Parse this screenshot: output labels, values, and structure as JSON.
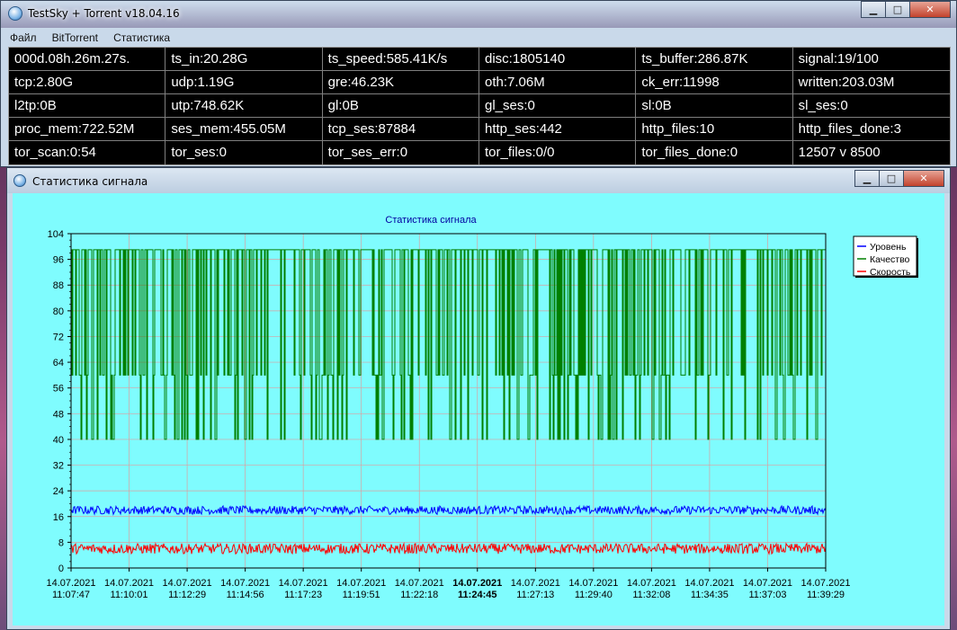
{
  "window": {
    "title": "TestSky + Torrent v18.04.16"
  },
  "menu": [
    "Файл",
    "BitTorrent",
    "Статистика"
  ],
  "stats": [
    [
      "000d.08h.26m.27s.",
      "ts_in:20.28G",
      "ts_speed:585.41K/s",
      "disc:1805140",
      "ts_buffer:286.87K",
      "signal:19/100"
    ],
    [
      "tcp:2.80G",
      "udp:1.19G",
      "gre:46.23K",
      "oth:7.06M",
      "ck_err:11998",
      "written:203.03M"
    ],
    [
      "l2tp:0B",
      "utp:748.62K",
      "gl:0B",
      "gl_ses:0",
      "sl:0B",
      "sl_ses:0"
    ],
    [
      "proc_mem:722.52M",
      "ses_mem:455.05M",
      "tcp_ses:87884",
      "http_ses:442",
      "http_files:10",
      "http_files_done:3"
    ],
    [
      "tor_scan:0:54",
      "tor_ses:0",
      "tor_ses_err:0",
      "tor_files:0/0",
      "tor_files_done:0",
      "12507 v 8500"
    ]
  ],
  "child_window": {
    "title": "Статистика сигнала"
  },
  "colors": {
    "background": "#7ffcfe",
    "level": "#0000ff",
    "quality": "#008000",
    "speed": "#ff0000",
    "grid": "#d9a0a0"
  },
  "chart_data": {
    "type": "line",
    "title": "Статистика сигнала",
    "ylim": [
      0,
      104
    ],
    "yticks": [
      0,
      8,
      16,
      24,
      32,
      40,
      48,
      56,
      64,
      72,
      80,
      88,
      96,
      104
    ],
    "xticks": [
      {
        "date": "14.07.2021",
        "time": "11:07:47",
        "bold": false
      },
      {
        "date": "14.07.2021",
        "time": "11:10:01",
        "bold": false
      },
      {
        "date": "14.07.2021",
        "time": "11:12:29",
        "bold": false
      },
      {
        "date": "14.07.2021",
        "time": "11:14:56",
        "bold": false
      },
      {
        "date": "14.07.2021",
        "time": "11:17:23",
        "bold": false
      },
      {
        "date": "14.07.2021",
        "time": "11:19:51",
        "bold": false
      },
      {
        "date": "14.07.2021",
        "time": "11:22:18",
        "bold": false
      },
      {
        "date": "14.07.2021",
        "time": "11:24:45",
        "bold": true
      },
      {
        "date": "14.07.2021",
        "time": "11:27:13",
        "bold": false
      },
      {
        "date": "14.07.2021",
        "time": "11:29:40",
        "bold": false
      },
      {
        "date": "14.07.2021",
        "time": "11:32:08",
        "bold": false
      },
      {
        "date": "14.07.2021",
        "time": "11:34:35",
        "bold": false
      },
      {
        "date": "14.07.2021",
        "time": "11:37:03",
        "bold": false
      },
      {
        "date": "14.07.2021",
        "time": "11:39:29",
        "bold": false
      }
    ],
    "legend_placement": "top-right",
    "series": [
      {
        "name": "Уровень",
        "color": "#0000ff",
        "baseline": 18,
        "jitter": 1.3
      },
      {
        "name": "Качество",
        "color": "#008000",
        "high": 99,
        "levels": [
          40,
          60
        ],
        "density": 0.6
      },
      {
        "name": "Скорость",
        "color": "#ff0000",
        "baseline": 6,
        "jitter": 1.6
      }
    ]
  }
}
